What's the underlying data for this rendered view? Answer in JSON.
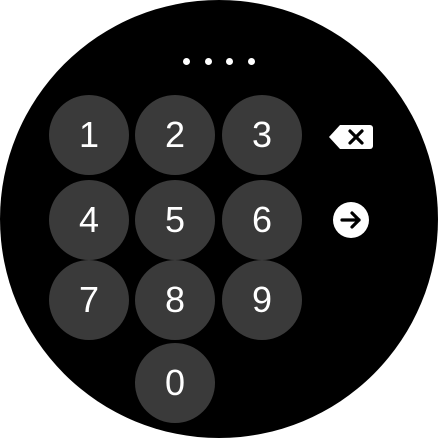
{
  "pin": {
    "entered_count": 4
  },
  "keypad": {
    "keys": [
      "1",
      "2",
      "3",
      "4",
      "5",
      "6",
      "7",
      "8",
      "9",
      "0"
    ]
  },
  "actions": {
    "backspace_icon": "backspace-icon",
    "enter_icon": "arrow-right-circle-icon"
  },
  "colors": {
    "background": "#000000",
    "key_fill": "#3a3a3a",
    "foreground": "#ffffff"
  }
}
